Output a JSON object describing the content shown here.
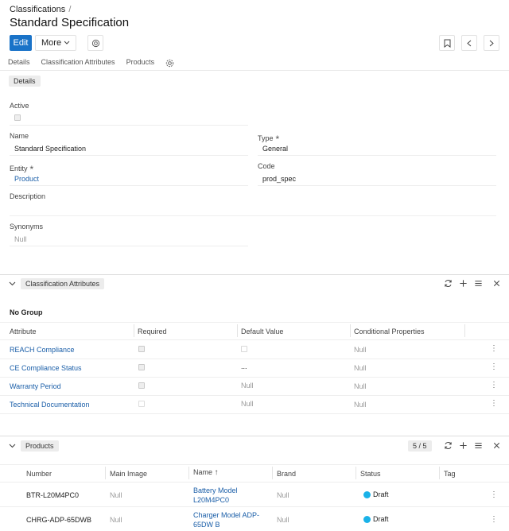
{
  "breadcrumb": {
    "parent": "Classifications",
    "sep": "/"
  },
  "title": "Standard Specification",
  "toolbar": {
    "edit": "Edit",
    "more": "More"
  },
  "tabs": [
    "Details",
    "Classification Attributes",
    "Products"
  ],
  "details": {
    "chip": "Details",
    "active_label": "Active",
    "name_label": "Name",
    "name_value": "Standard Specification",
    "type_label": "Type",
    "type_value": "General",
    "entity_label": "Entity",
    "entity_value": "Product",
    "code_label": "Code",
    "code_value": "prod_spec",
    "description_label": "Description",
    "synonyms_label": "Synonyms",
    "synonyms_value": "Null",
    "required_mark": "*"
  },
  "class_attrs": {
    "chip": "Classification Attributes",
    "group": "No Group",
    "columns": [
      "Attribute",
      "Required",
      "Default Value",
      "Conditional Properties"
    ],
    "rows": [
      {
        "attribute": "REACH Compliance",
        "default": "",
        "conditional": "Null"
      },
      {
        "attribute": "CE Compliance Status",
        "default": "...",
        "conditional": "Null"
      },
      {
        "attribute": "Warranty Period",
        "default": "Null",
        "conditional": "Null"
      },
      {
        "attribute": "Technical Documentation",
        "default": "Null",
        "conditional": "Null"
      }
    ]
  },
  "products": {
    "chip": "Products",
    "count": "5 / 5",
    "columns": [
      "Number",
      "Main Image",
      "Name",
      "Brand",
      "Status",
      "Tag"
    ],
    "sort_arrow": "↑",
    "rows": [
      {
        "number": "BTR-L20M4PC0",
        "image": "Null",
        "name_line1": "Battery Model",
        "name_line2": "L20M4PC0",
        "brand": "Null",
        "status": "Draft"
      },
      {
        "number": "CHRG-ADP-65DWB",
        "image": "Null",
        "name_line1": "Charger Model ADP-",
        "name_line2": "65DW B",
        "brand": "Null",
        "status": "Draft"
      }
    ]
  },
  "colors": {
    "primary": "#1a73c8",
    "link": "#1a5ea8",
    "status_draft": "#1ab2e8"
  }
}
